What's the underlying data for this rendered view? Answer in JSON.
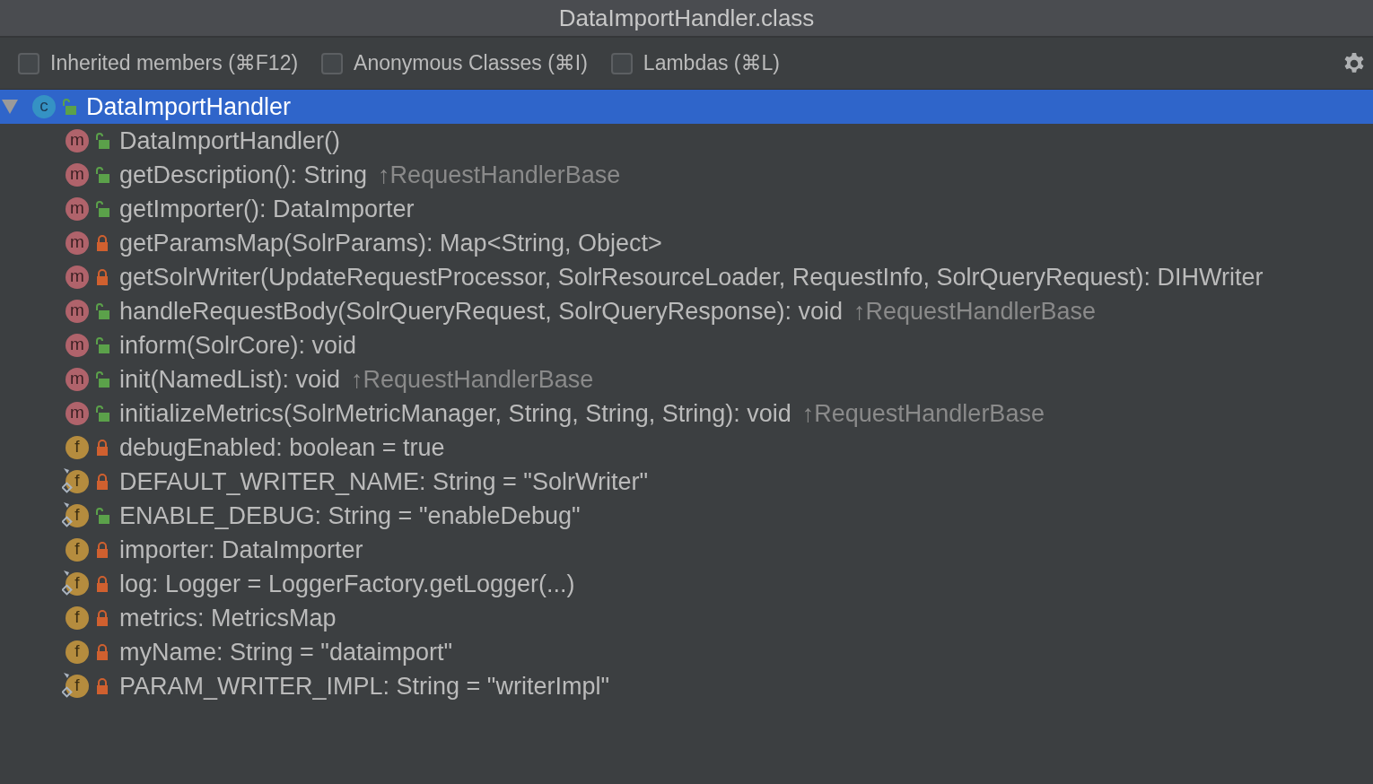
{
  "window": {
    "title": "DataImportHandler.class"
  },
  "filters": [
    {
      "label": "Inherited members (⌘F12)",
      "checked": false
    },
    {
      "label": "Anonymous Classes (⌘I)",
      "checked": false
    },
    {
      "label": "Lambdas (⌘L)",
      "checked": false
    }
  ],
  "tree": {
    "kind": "class",
    "icon_letter": "c",
    "private": false,
    "name": "DataImportHandler",
    "selected": true,
    "expanded": true,
    "children": [
      {
        "kind": "method",
        "icon_letter": "m",
        "private": false,
        "static": false,
        "signature": "DataImportHandler()",
        "selected": false
      },
      {
        "kind": "method",
        "icon_letter": "m",
        "private": false,
        "static": false,
        "signature": "getDescription(): String",
        "inherited": "↑RequestHandlerBase",
        "selected": false
      },
      {
        "kind": "method",
        "icon_letter": "m",
        "private": false,
        "static": false,
        "signature": "getImporter(): DataImporter",
        "selected": false
      },
      {
        "kind": "method",
        "icon_letter": "m",
        "private": true,
        "static": false,
        "signature": "getParamsMap(SolrParams): Map<String, Object>",
        "selected": false
      },
      {
        "kind": "method",
        "icon_letter": "m",
        "private": true,
        "static": false,
        "signature": "getSolrWriter(UpdateRequestProcessor, SolrResourceLoader, RequestInfo, SolrQueryRequest): DIHWriter",
        "selected": false
      },
      {
        "kind": "method",
        "icon_letter": "m",
        "private": false,
        "static": false,
        "signature": "handleRequestBody(SolrQueryRequest, SolrQueryResponse): void",
        "inherited": "↑RequestHandlerBase",
        "selected": false
      },
      {
        "kind": "method",
        "icon_letter": "m",
        "private": false,
        "static": false,
        "signature": "inform(SolrCore): void",
        "selected": false
      },
      {
        "kind": "method",
        "icon_letter": "m",
        "private": false,
        "static": false,
        "signature": "init(NamedList): void",
        "inherited": "↑RequestHandlerBase",
        "selected": false
      },
      {
        "kind": "method",
        "icon_letter": "m",
        "private": false,
        "static": false,
        "signature": "initializeMetrics(SolrMetricManager, String, String, String): void",
        "inherited": "↑RequestHandlerBase",
        "selected": false
      },
      {
        "kind": "field",
        "icon_letter": "f",
        "private": true,
        "static": false,
        "signature": "debugEnabled: boolean = true",
        "selected": false
      },
      {
        "kind": "field",
        "icon_letter": "f",
        "private": true,
        "static": true,
        "signature": "DEFAULT_WRITER_NAME: String = \"SolrWriter\"",
        "selected": false
      },
      {
        "kind": "field",
        "icon_letter": "f",
        "private": false,
        "static": true,
        "signature": "ENABLE_DEBUG: String = \"enableDebug\"",
        "selected": false
      },
      {
        "kind": "field",
        "icon_letter": "f",
        "private": true,
        "static": false,
        "signature": "importer: DataImporter",
        "selected": false
      },
      {
        "kind": "field",
        "icon_letter": "f",
        "private": true,
        "static": true,
        "signature": "log: Logger = LoggerFactory.getLogger(...)",
        "selected": false
      },
      {
        "kind": "field",
        "icon_letter": "f",
        "private": true,
        "static": false,
        "signature": "metrics: MetricsMap",
        "selected": false
      },
      {
        "kind": "field",
        "icon_letter": "f",
        "private": true,
        "static": false,
        "signature": "myName: String = \"dataimport\"",
        "selected": false
      },
      {
        "kind": "field",
        "icon_letter": "f",
        "private": true,
        "static": true,
        "signature": "PARAM_WRITER_IMPL: String = \"writerImpl\"",
        "selected": false
      }
    ]
  }
}
